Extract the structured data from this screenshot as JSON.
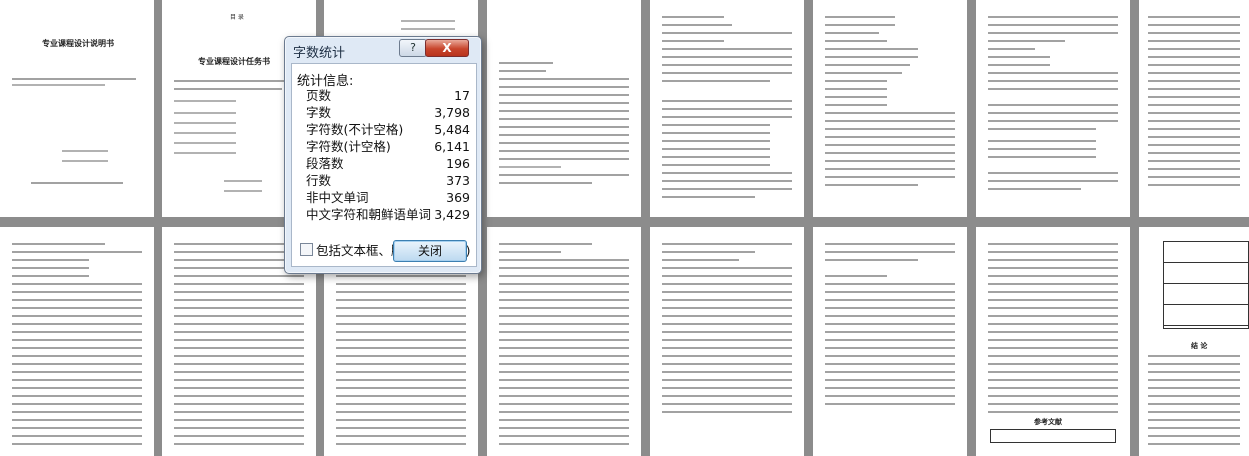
{
  "dialog": {
    "title": "字数统计",
    "help_label": "?",
    "close_label": "X",
    "section_label": "统计信息:",
    "stats": [
      {
        "label": "页数",
        "value": "17"
      },
      {
        "label": "字数",
        "value": "3,798"
      },
      {
        "label": "字符数(不计空格)",
        "value": "5,484"
      },
      {
        "label": "字符数(计空格)",
        "value": "6,141"
      },
      {
        "label": "段落数",
        "value": "196"
      },
      {
        "label": "行数",
        "value": "373"
      },
      {
        "label": "非中文单词",
        "value": "369"
      },
      {
        "label": "中文字符和朝鲜语单词",
        "value": "3,429"
      }
    ],
    "checkbox_label": "包括文本框、脚注和尾注(F)",
    "checkbox_checked": false,
    "ok_label": "关闭"
  },
  "document": {
    "page_titles": [
      "专业课程设计说明书",
      "专业课程设计任务书",
      "参考文献"
    ],
    "end_heading": "结 论",
    "page_header_mark": "目 录"
  }
}
